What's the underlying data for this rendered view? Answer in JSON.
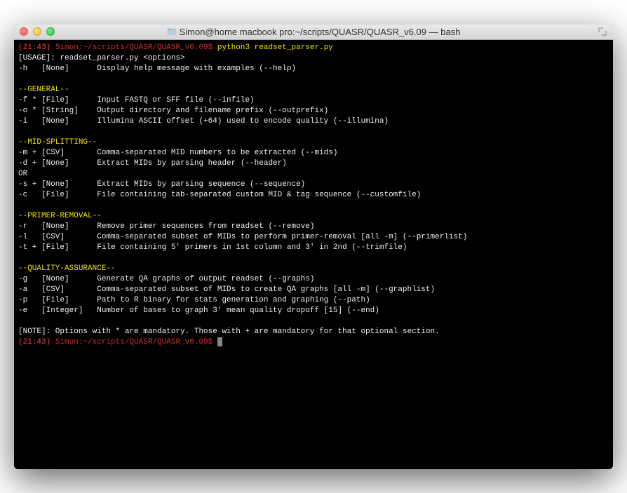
{
  "window": {
    "title": "Simon@home macbook pro:~/scripts/QUASR/QUASR_v6.09 — bash"
  },
  "prompt": {
    "time1": "(21:43)",
    "path1": "Simon:~/scripts/QUASR/QUASR_v6.09$",
    "command": "python3 readset_parser.py",
    "time2": "(21:43)",
    "path2": "Simon:~/scripts/QUASR/QUASR_v6.09$"
  },
  "lines": {
    "usage": "[USAGE]: readset_parser.py <options>",
    "h": "-h   [None]      Display help message with examples (--help)",
    "blank1": "",
    "hdr_general": "--GENERAL--",
    "f": "-f * [File]      Input FASTQ or SFF file (--infile)",
    "o": "-o * [String]    Output directory and filename prefix (--outprefix)",
    "i": "-i   [None]      Illumina ASCII offset (+64) used to encode quality (--illumina)",
    "blank2": "",
    "hdr_mid": "--MID-SPLITTING--",
    "m": "-m + [CSV]       Comma-separated MID numbers to be extracted (--mids)",
    "d": "-d + [None]      Extract MIDs by parsing header (--header)",
    "or": "OR",
    "s": "-s + [None]      Extract MIDs by parsing sequence (--sequence)",
    "c": "-c   [File]      File containing tab-separated custom MID & tag sequence (--customfile)",
    "blank3": "",
    "hdr_primer": "--PRIMER-REMOVAL--",
    "r": "-r   [None]      Remove primer sequences from readset (--remove)",
    "l": "-l   [CSV]       Comma-separated subset of MIDs to perform primer-removal [all -m] (--primerlist)",
    "t": "-t + [File]      File containing 5' primers in 1st column and 3' in 2nd (--trimfile)",
    "blank4": "",
    "hdr_qa": "--QUALITY-ASSURANCE--",
    "g": "-g   [None]      Generate QA graphs of output readset (--graphs)",
    "a": "-a   [CSV]       Comma-separated subset of MIDs to create QA graphs [all -m] (--graphlist)",
    "p": "-p   [File]      Path to R binary for stats generation and graphing (--path)",
    "e": "-e   [Integer]   Number of bases to graph 3' mean quality dropoff [15] (--end)",
    "blank5": "",
    "note": "[NOTE]: Options with * are mandatory. Those with + are mandatory for that optional section."
  }
}
